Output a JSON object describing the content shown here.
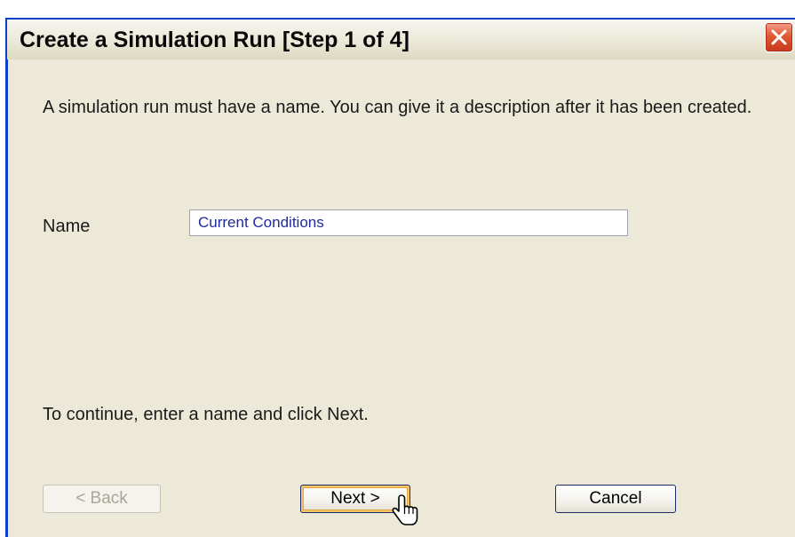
{
  "window": {
    "title": "Create a Simulation Run [Step 1 of 4]",
    "close_icon": "close-icon"
  },
  "body": {
    "intro": "A simulation run must have a name. You can give it a description after it has been created.",
    "name_label": "Name",
    "name_value": "Current Conditions",
    "hint": "To continue, enter a name and click Next."
  },
  "buttons": {
    "back": "< Back",
    "next": "Next >",
    "cancel": "Cancel"
  },
  "colors": {
    "title_frame": "#0d3fcf",
    "dialog_face": "#ece9d8",
    "close_button": "#e05a33",
    "input_text": "#1f2a9c",
    "focus_ring": "#f6c567"
  },
  "cursor_icon": "hand-pointer-icon"
}
